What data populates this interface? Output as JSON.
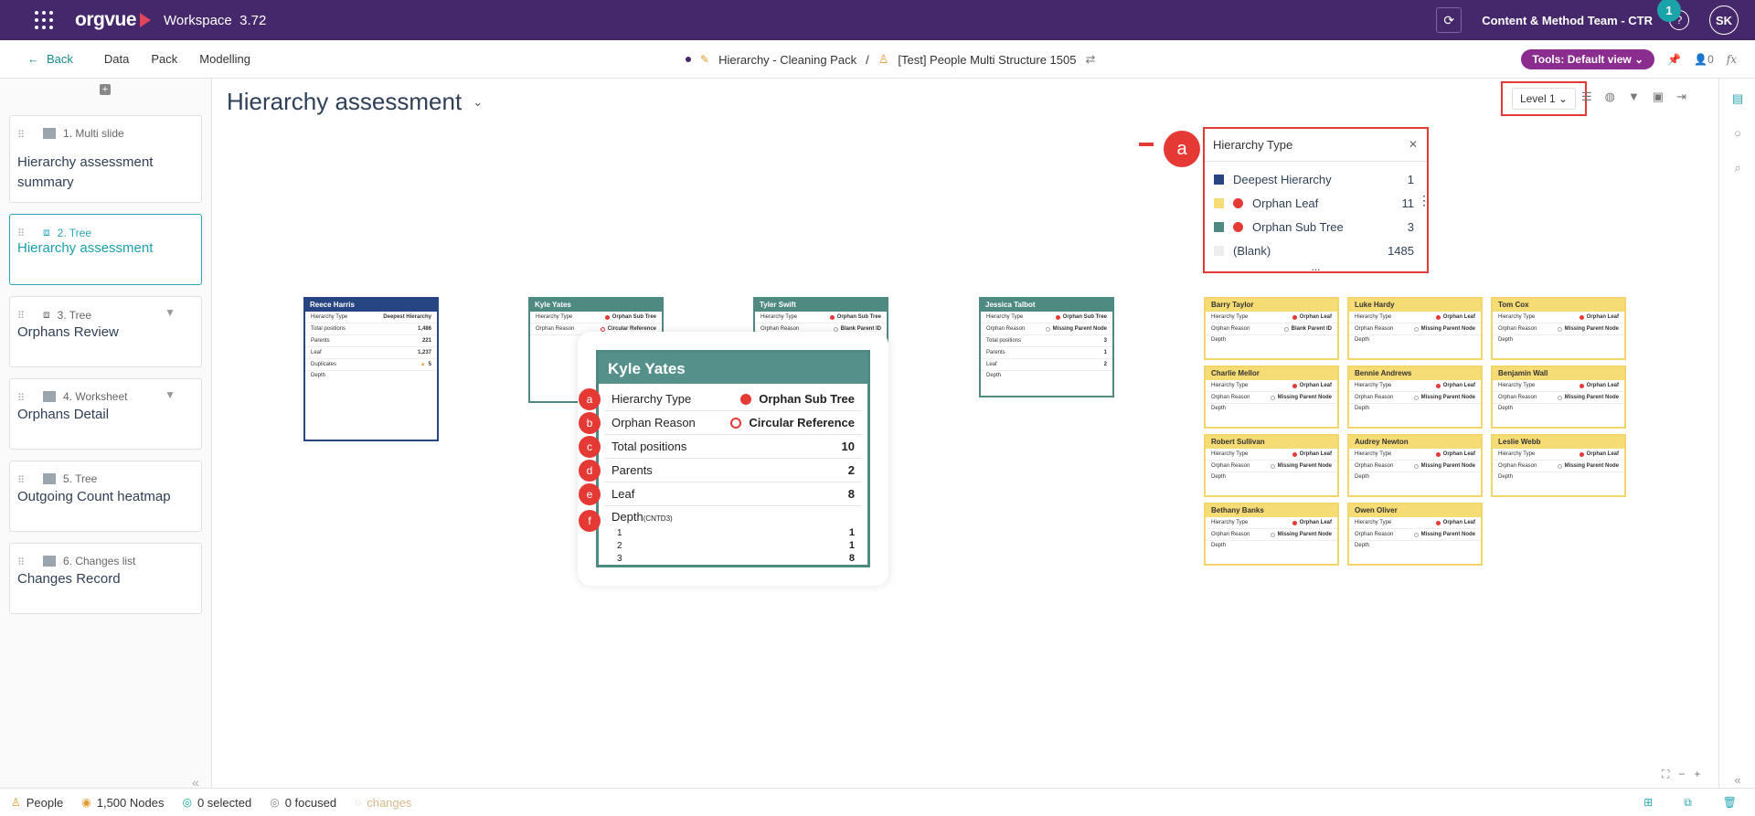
{
  "topbar": {
    "logo": "orgvue",
    "workspace_label": "Workspace",
    "version": "3.72",
    "team": "Content & Method Team - CTR",
    "notification_count": "1",
    "help": "?",
    "avatar_initials": "SK"
  },
  "subnav": {
    "back": "Back",
    "items": [
      "Data",
      "Pack",
      "Modelling"
    ],
    "breadcrumb_pack": "Hierarchy - Cleaning Pack",
    "separator": "/",
    "breadcrumb_dataset": "[Test] People Multi Structure 1505",
    "tools_label": "Tools: Default view",
    "user_count": "0",
    "fx": "fx"
  },
  "slides": [
    {
      "type": "1. Multi slide",
      "title": "Hierarchy assessment summary"
    },
    {
      "type": "2. Tree",
      "title": "Hierarchy assessment"
    },
    {
      "type": "3. Tree",
      "title": "Orphans Review"
    },
    {
      "type": "4. Worksheet",
      "title": "Orphans Detail"
    },
    {
      "type": "5. Tree",
      "title": "Outgoing Count heatmap"
    },
    {
      "type": "6. Changes list",
      "title": "Changes Record"
    }
  ],
  "main": {
    "title": "Hierarchy assessment",
    "level_select": "Level 1"
  },
  "legend": {
    "title": "Hierarchy Type",
    "callout": "a",
    "rows": [
      {
        "label": "Deepest Hierarchy",
        "count": "1",
        "color": "#274583"
      },
      {
        "label": "Orphan Leaf",
        "count": "11",
        "color": "#f6dc75"
      },
      {
        "label": "Orphan Sub Tree",
        "count": "3",
        "color": "#4f8a82"
      },
      {
        "label": "(Blank)",
        "count": "1485",
        "color": "#eeeeee"
      }
    ],
    "more": "..."
  },
  "labels": {
    "hierarchy_type": "Hierarchy Type",
    "orphan_reason": "Orphan Reason",
    "total_positions": "Total positions",
    "parents": "Parents",
    "leaf": "Leaf",
    "duplicates": "Duplicates",
    "depth": "Depth",
    "depth_small": "(CNTD3)"
  },
  "tree_cards": {
    "reece": {
      "name": "Reece Harris",
      "type": "Deepest Hierarchy",
      "total": "1,486",
      "parents": "221",
      "leaf": "1,237",
      "duplicates": "5"
    },
    "kyle": {
      "name": "Kyle Yates",
      "type": "Orphan Sub Tree",
      "reason": "Circular Reference"
    },
    "tyler": {
      "name": "Tyler Swift",
      "type": "Orphan Sub Tree",
      "reason": "Blank Parent ID"
    },
    "jessica": {
      "name": "Jessica Talbot",
      "type": "Orphan Sub Tree",
      "reason": "Missing Parent Node",
      "total": "3",
      "parents": "1",
      "leaf": "2"
    }
  },
  "orphan_leaf_cards": [
    {
      "name": "Barry Taylor",
      "type": "Orphan Leaf",
      "reason": "Blank Parent ID"
    },
    {
      "name": "Luke Hardy",
      "type": "Orphan Leaf",
      "reason": "Missing Parent Node"
    },
    {
      "name": "Tom Cox",
      "type": "Orphan Leaf",
      "reason": "Missing Parent Node"
    },
    {
      "name": "Charlie Mellor",
      "type": "Orphan Leaf",
      "reason": "Missing Parent Node"
    },
    {
      "name": "Bennie Andrews",
      "type": "Orphan Leaf",
      "reason": "Missing Parent Node"
    },
    {
      "name": "Benjamin Wall",
      "type": "Orphan Leaf",
      "reason": "Missing Parent Node"
    },
    {
      "name": "Robert Sullivan",
      "type": "Orphan Leaf",
      "reason": "Missing Parent Node"
    },
    {
      "name": "Audrey Newton",
      "type": "Orphan Leaf",
      "reason": "Missing Parent Node"
    },
    {
      "name": "Leslie Webb",
      "type": "Orphan Leaf",
      "reason": "Missing Parent Node"
    },
    {
      "name": "Bethany Banks",
      "type": "Orphan Leaf",
      "reason": "Missing Parent Node"
    },
    {
      "name": "Owen Oliver",
      "type": "Orphan Leaf",
      "reason": "Missing Parent Node"
    }
  ],
  "zoom_card": {
    "name": "Kyle Yates",
    "type": "Orphan Sub Tree",
    "reason": "Circular Reference",
    "total": "10",
    "parents": "2",
    "leaf": "8",
    "depth_rows": [
      "1",
      "2",
      "3"
    ],
    "depth_vals": [
      "1",
      "1",
      "8"
    ],
    "badges": [
      "a",
      "b",
      "c",
      "d",
      "e",
      "f"
    ]
  },
  "status": {
    "dataset": "People",
    "nodes": "1,500 Nodes",
    "selected": "0 selected",
    "focused": "0 focused",
    "changes": "changes"
  }
}
